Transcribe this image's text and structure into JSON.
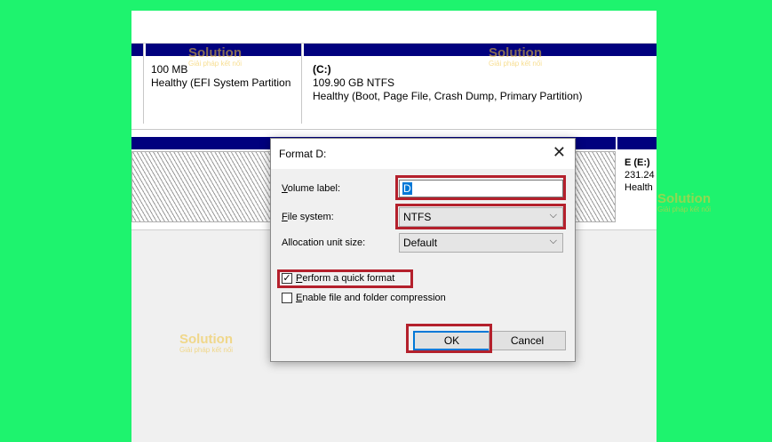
{
  "colors": {
    "background": "#1ef36e",
    "partition_bar": "#01017e",
    "highlight": "#b4202c",
    "button_focus": "#0078d7"
  },
  "disk0": {
    "efi": {
      "size": "100 MB",
      "status": "Healthy (EFI System Partition"
    },
    "c": {
      "name": "(C:)",
      "size": "109.90 GB NTFS",
      "status": "Healthy (Boot, Page File, Crash Dump, Primary Partition)"
    }
  },
  "disk1": {
    "e": {
      "name": "E  (E:)",
      "size": "231.24",
      "status": "Health"
    }
  },
  "dialog": {
    "title": "Format D:",
    "close_glyph": "✕",
    "volume_label_text": "olume label:",
    "volume_label_key": "V",
    "volume_label_value": "D",
    "file_system_text": "ile system:",
    "file_system_key": "F",
    "file_system_value": "NTFS",
    "allocation_label": "Allocation unit size:",
    "allocation_value": "Default",
    "dropdown_arrow": "⌵",
    "quick_format_key": "P",
    "quick_format_text": "erform a quick format",
    "quick_format_checked": true,
    "check_glyph": "✓",
    "compression_key": "E",
    "compression_text": "nable file and folder compression",
    "compression_checked": false,
    "ok_label": "OK",
    "cancel_label": "Cancel"
  },
  "watermark": {
    "brand": "Solution",
    "tagline": "Giải pháp kết nối"
  }
}
